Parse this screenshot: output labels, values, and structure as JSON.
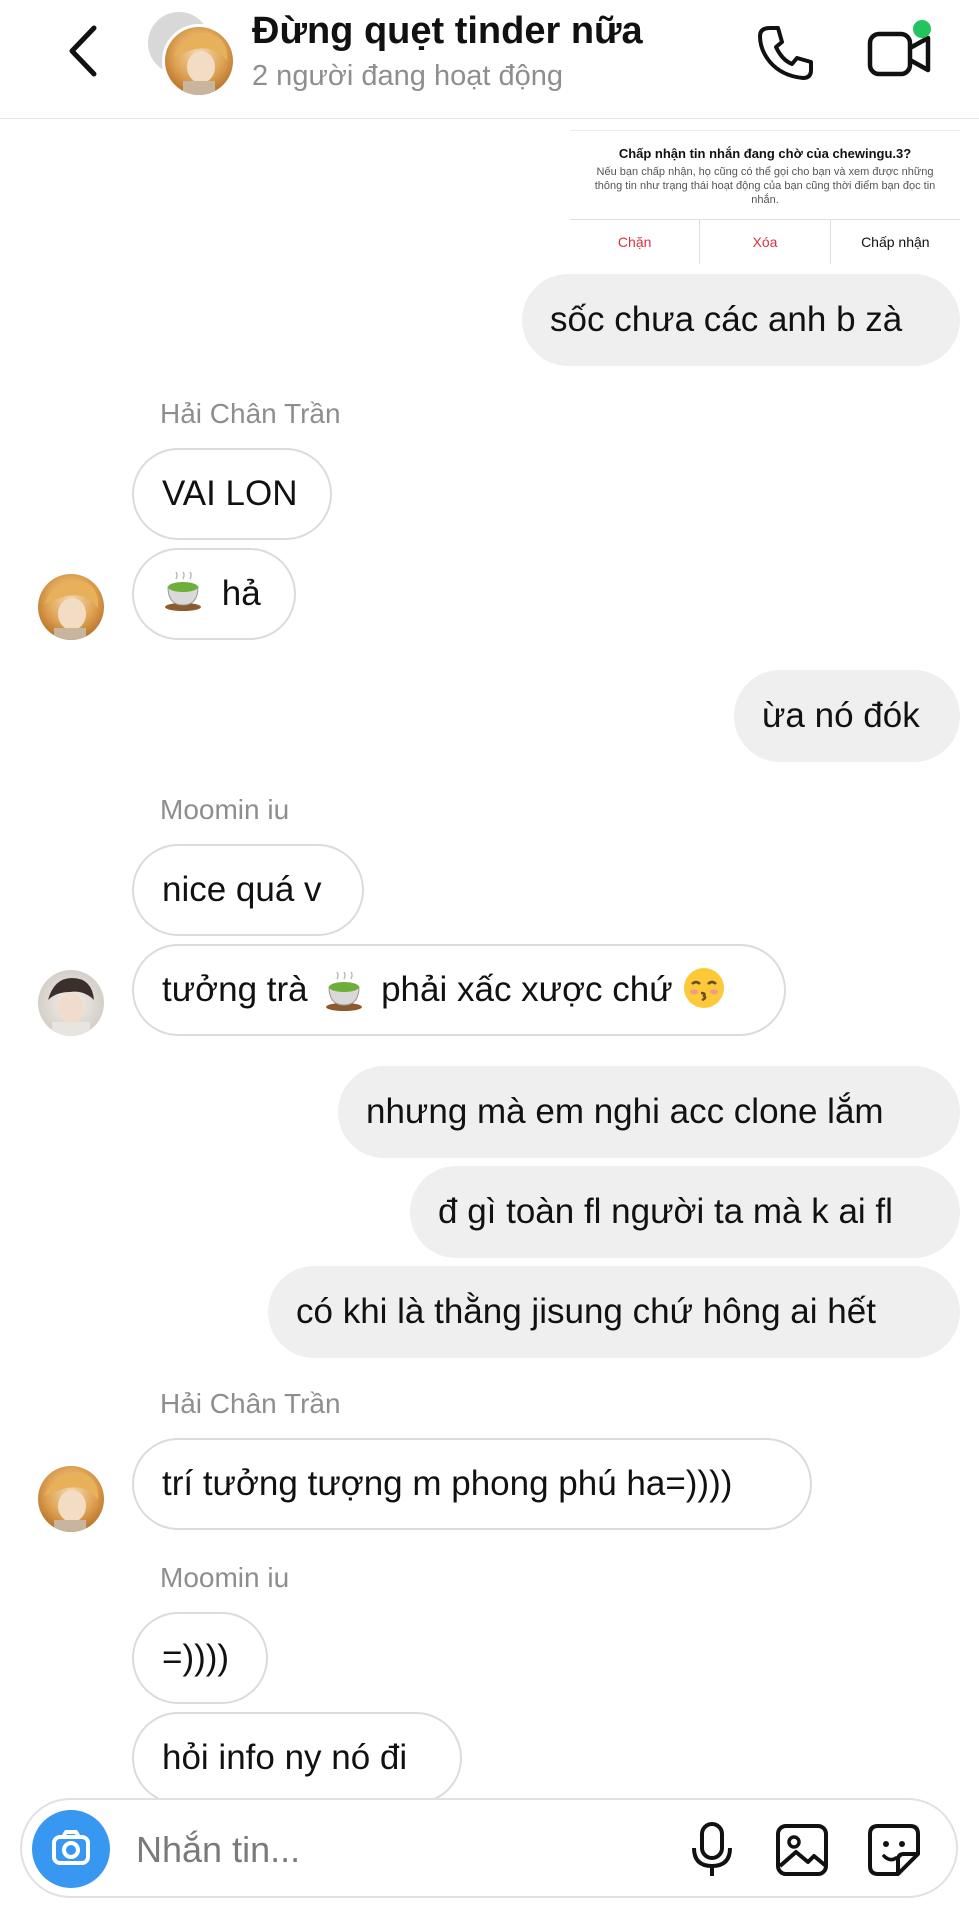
{
  "header": {
    "title": "Đừng quẹt tinder nữa",
    "subtitle": "2 người đang hoạt động",
    "icons": [
      "back-arrow-icon",
      "phone-icon",
      "video-call-icon"
    ],
    "online_indicator_color": "#22c45e"
  },
  "request": {
    "title": "Chấp nhận tin nhắn đang chờ của chewingu.3?",
    "description": "Nếu bạn chấp nhận, họ cũng có thể gọi cho bạn và xem được những thông tin như trạng thái hoạt động của bạn cũng thời điểm bạn đọc tin nhắn.",
    "block_label": "Chặn",
    "delete_label": "Xóa",
    "accept_label": "Chấp nhận"
  },
  "messages": {
    "m1": "sốc chưa các anh b zà",
    "s1": "Hải Chân Trần",
    "m2": "VAI LON",
    "m3": "hả",
    "m4": "ừa nó đók",
    "s2": "Moomin iu",
    "m5": "nice quá v",
    "m6a": "tưởng trà",
    "m6b": "phải xấc xược chứ",
    "m7": "nhưng mà em nghi acc clone lắm",
    "m8": "đ gì toàn fl người ta mà k ai fl",
    "m9": "có khi là thằng jisung chứ hông ai hết",
    "s3": "Hải Chân Trần",
    "m10": "trí tưởng tượng m phong phú ha=))))",
    "s4": "Moomin iu",
    "m11": "=))))",
    "m12": "hỏi info ny nó đi"
  },
  "composer": {
    "placeholder": "Nhắn tin...",
    "icons": [
      "camera-icon",
      "microphone-icon",
      "gallery-icon",
      "sticker-icon"
    ],
    "accent_color": "#3897f0"
  },
  "colors": {
    "outgoing_bubble": "#efefef",
    "incoming_border": "#dbdbdb",
    "muted_text": "#8e8e8e",
    "danger": "#d8323f"
  }
}
